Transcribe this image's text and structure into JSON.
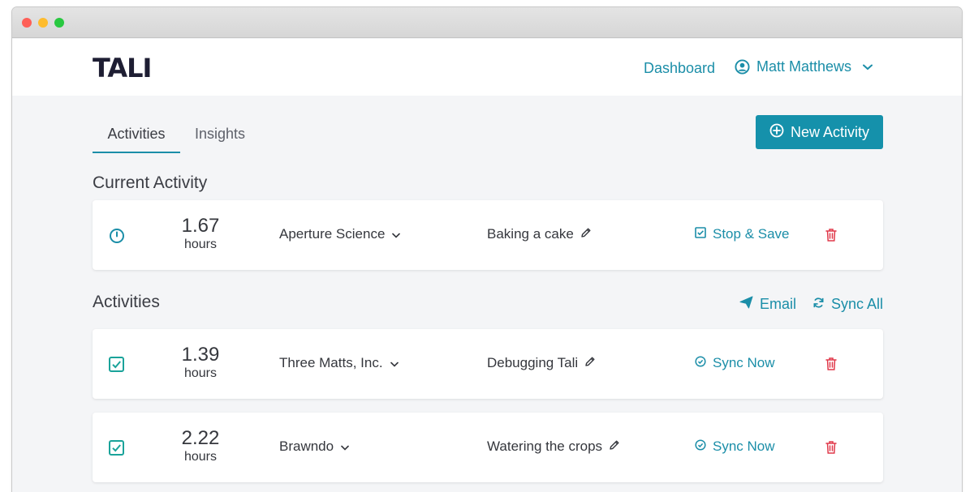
{
  "app": {
    "logo": "TALI"
  },
  "header": {
    "dashboard_label": "Dashboard",
    "user_name": "Matt Matthews"
  },
  "tabs": [
    {
      "label": "Activities",
      "active": true
    },
    {
      "label": "Insights",
      "active": false
    }
  ],
  "toolbar": {
    "new_activity_label": "New Activity"
  },
  "current": {
    "title": "Current Activity",
    "activity": {
      "hours": "1.67",
      "unit": "hours",
      "client": "Aperture Science",
      "description": "Baking a cake",
      "action_label": "Stop & Save"
    }
  },
  "activities": {
    "title": "Activities",
    "email_label": "Email",
    "sync_all_label": "Sync All",
    "items": [
      {
        "hours": "1.39",
        "unit": "hours",
        "client": "Three Matts, Inc.",
        "description": "Debugging Tali",
        "action_label": "Sync Now"
      },
      {
        "hours": "2.22",
        "unit": "hours",
        "client": "Brawndo",
        "description": "Watering the crops",
        "action_label": "Sync Now"
      }
    ]
  },
  "colors": {
    "accent": "#1591ab",
    "link": "#1b8ea8",
    "check": "#1aa39a",
    "danger": "#e0394a",
    "background": "#f4f5f7"
  },
  "icons": {
    "clock": "clock-icon",
    "check": "checkbox-checked-icon",
    "edit": "pencil-icon",
    "delete": "trash-icon",
    "email": "paper-plane-icon",
    "sync": "refresh-icon",
    "user": "user-circle-icon",
    "add": "plus-circle-icon"
  }
}
